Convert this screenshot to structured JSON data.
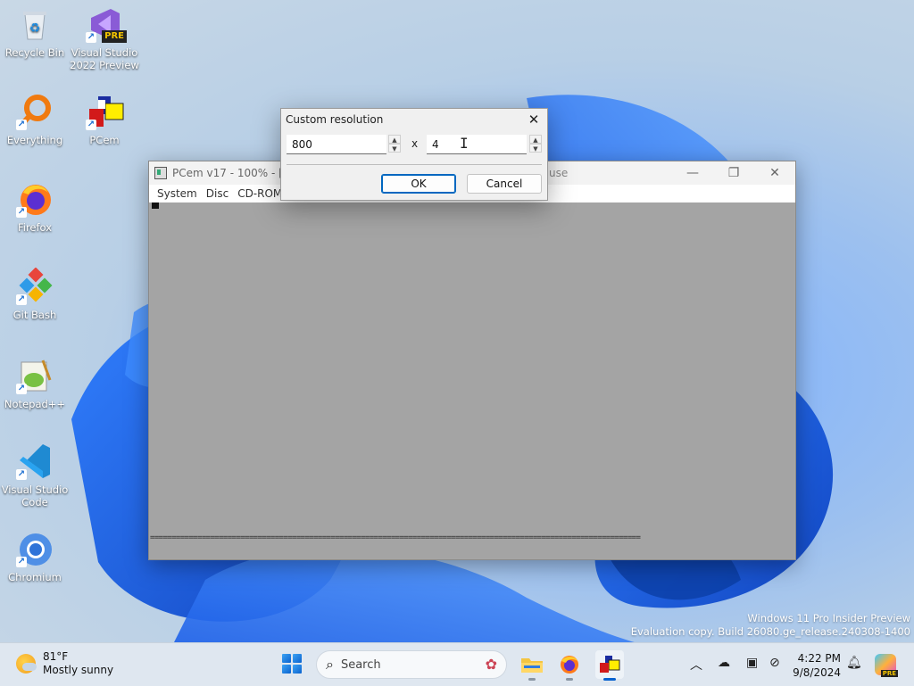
{
  "desktop": {
    "icons": [
      {
        "label": "Recycle Bin"
      },
      {
        "label": "Visual Studio 2022 Preview",
        "badge": "PRE"
      },
      {
        "label": "Everything"
      },
      {
        "label": "PCem"
      },
      {
        "label": "Firefox"
      },
      {
        "label": "Git Bash"
      },
      {
        "label": "Notepad++"
      },
      {
        "label": "Visual Studio Code"
      },
      {
        "label": "Chromium"
      }
    ]
  },
  "pcem_window": {
    "title": "PCem v17 - 100% - [38",
    "title_tail": "use",
    "menu": [
      "System",
      "Disc",
      "CD-ROM"
    ],
    "screen_line": "=================================================================================================================="
  },
  "dialog": {
    "title": "Custom resolution",
    "width_value": "800",
    "separator": "x",
    "height_value": "4",
    "ok_label": "OK",
    "cancel_label": "Cancel"
  },
  "watermark": {
    "line1": "Windows 11 Pro Insider Preview",
    "line2": "Evaluation copy. Build 26080.ge_release.240308-1400"
  },
  "taskbar": {
    "weather_temp": "81°F",
    "weather_desc": "Mostly sunny",
    "search_placeholder": "Search",
    "time": "4:22 PM",
    "date": "9/8/2024"
  }
}
